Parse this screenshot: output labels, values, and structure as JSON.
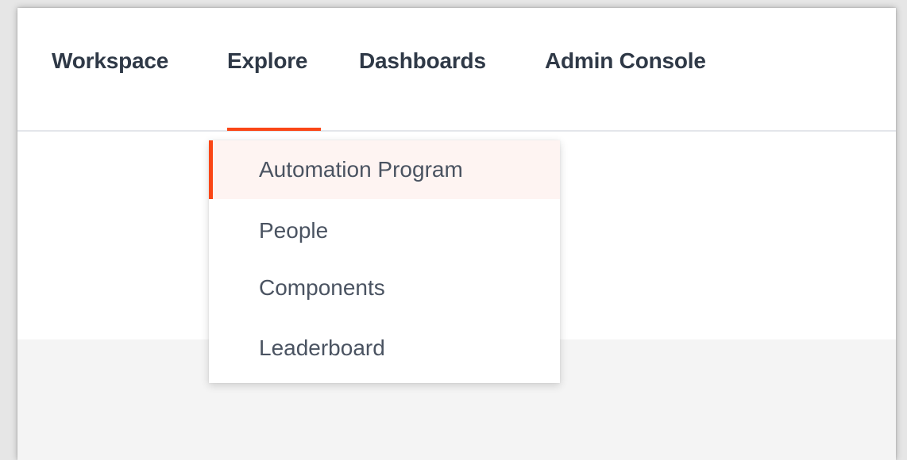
{
  "topnav": {
    "items": [
      {
        "label": "Workspace"
      },
      {
        "label": "Explore",
        "active": true
      },
      {
        "label": "Dashboards"
      },
      {
        "label": "Admin Console"
      }
    ]
  },
  "explore_menu": {
    "items": [
      {
        "label": "Automation Program",
        "active": true
      },
      {
        "label": "People"
      },
      {
        "label": "Components"
      },
      {
        "label": "Leaderboard"
      }
    ]
  },
  "colors": {
    "accent": "#fa4616",
    "nav_text": "#2f3947",
    "menu_text": "#4a5361",
    "active_bg": "#fef4f2"
  }
}
